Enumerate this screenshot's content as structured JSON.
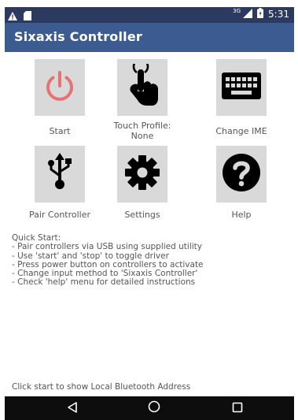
{
  "status_bar": {
    "network": "3G",
    "time": "5:31",
    "icons": [
      "warning-icon",
      "sd-card-icon",
      "signal-icon",
      "battery-icon"
    ]
  },
  "app_bar": {
    "title": "Sixaxis Controller"
  },
  "grid": [
    {
      "id": "start",
      "label": "Start",
      "icon": "power-icon",
      "icon_color": "#e57373"
    },
    {
      "id": "touch_profile",
      "label": "Touch Profile:",
      "sublabel": "None",
      "icon": "touch-hand-icon",
      "icon_color": "#000000"
    },
    {
      "id": "change_ime",
      "label": "Change IME",
      "icon": "keyboard-icon",
      "icon_color": "#000000"
    },
    {
      "id": "pair_controller",
      "label": "Pair Controller",
      "icon": "usb-icon",
      "icon_color": "#000000"
    },
    {
      "id": "settings",
      "label": "Settings",
      "icon": "gear-icon",
      "icon_color": "#000000"
    },
    {
      "id": "help",
      "label": "Help",
      "icon": "help-icon",
      "icon_color": "#000000"
    }
  ],
  "quick_start": {
    "title": "Quick Start:",
    "lines": [
      "- Pair controllers via USB using supplied utility",
      "- Use 'start' and 'stop' to toggle driver",
      "- Press power button on controllers to activate",
      "- Change input method to 'Sixaxis Controller'",
      "- Check 'help' menu for detailed instructions"
    ]
  },
  "footer_text": "Click start to show Local Bluetooth Address",
  "nav_bar": {
    "buttons": [
      "back-icon",
      "home-icon",
      "recents-icon"
    ]
  },
  "colors": {
    "status_bar": "#2b3a5e",
    "app_bar": "#3c5b91",
    "tile": "#d9d9d9",
    "power_icon": "#e57373",
    "nav_bar": "#0d0d0d"
  }
}
